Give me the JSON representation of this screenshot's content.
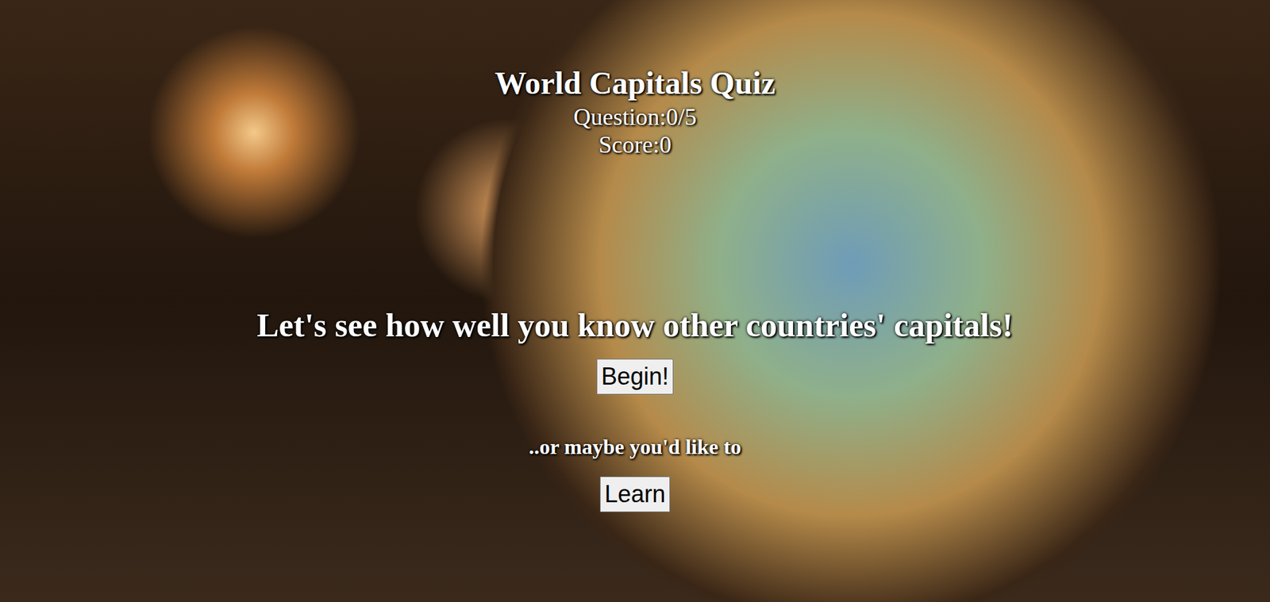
{
  "header": {
    "title": "World Capitals Quiz",
    "question": "Question:0/5",
    "score": "Score:0"
  },
  "intro": {
    "prompt": "Let's see how well you know other countries' capitals!",
    "begin_button": "Begin!",
    "alt_prompt": "..or maybe you'd like to",
    "learn_button": "Learn"
  }
}
